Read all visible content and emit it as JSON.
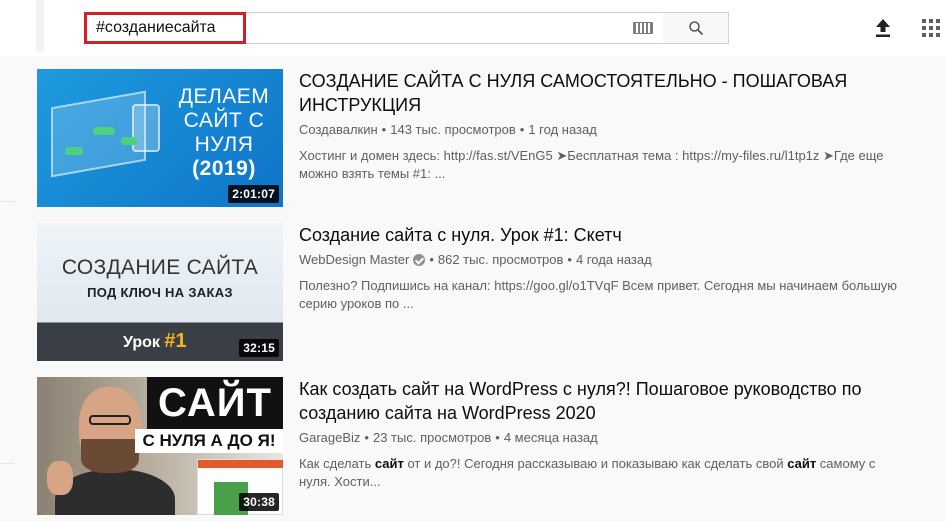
{
  "search": {
    "query": "#созданиесайта"
  },
  "results": [
    {
      "title": "СОЗДАНИЕ САЙТА С НУЛЯ САМОСТОЯТЕЛЬНО - ПОШАГОВАЯ ИНСТРУКЦИЯ",
      "channel": "Создавалкин",
      "views": "143 тыс. просмотров",
      "age": "1 год назад",
      "description": "Хостинг и домен здесь: http://fas.st/VEnG5 ➤Бесплатная тема : https://my-files.ru/l1tp1z ➤Где еще можно взять темы #1: ...",
      "duration": "2:01:07",
      "thumb_lines": [
        "ДЕЛАЕМ",
        "САЙТ С",
        "НУЛЯ",
        "(2019)"
      ]
    },
    {
      "title": "Создание сайта с нуля. Урок #1: Скетч",
      "channel": "WebDesign Master",
      "views": "862 тыс. просмотров",
      "age": "4 года назад",
      "description": "Полезно? Подпишись на канал: https://goo.gl/o1TVqF Всем привет. Сегодня мы начинаем большую серию уроков по ...",
      "duration": "32:15",
      "thumb_big": "СОЗДАНИЕ САЙТА",
      "thumb_small": "ПОД КЛЮЧ НА ЗАКАЗ",
      "thumb_lesson": "Урок",
      "thumb_lesson_num": "#1"
    },
    {
      "title": "Как создать сайт на WordPress с нуля?! Пошаговое руководство по созданию сайта на WordPress 2020",
      "channel": "GarageBiz",
      "views": "23 тыс. просмотров",
      "age": "4 месяца назад",
      "desc_parts": [
        "Как сделать ",
        "сайт",
        " от и до?! Сегодня рассказываю и показываю как сделать свой ",
        "сайт",
        " самому с нуля. Хости..."
      ],
      "duration": "30:38",
      "thumb_sign": "САЙТ",
      "thumb_sub": "С НУЛЯ А ДО Я!"
    }
  ]
}
